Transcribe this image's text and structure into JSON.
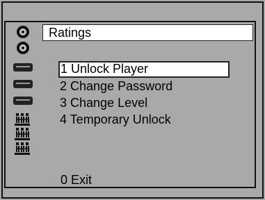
{
  "screen": {
    "title": "Ratings"
  },
  "menu": {
    "items": [
      {
        "label": "1 Unlock Player",
        "selected": true
      },
      {
        "label": "2 Change Password",
        "selected": false
      },
      {
        "label": "3 Change Level",
        "selected": false
      },
      {
        "label": "4 Temporary Unlock",
        "selected": false
      }
    ],
    "exit_label": "0 Exit"
  },
  "sidebar": {
    "icons": [
      "disc-icon",
      "disc-icon",
      "player-icon",
      "player-icon",
      "player-icon",
      "rating-icon",
      "rating-icon",
      "rating-icon"
    ]
  },
  "colors": {
    "background": "#a9a9a9",
    "highlight": "#ffffff",
    "text": "#000000"
  }
}
